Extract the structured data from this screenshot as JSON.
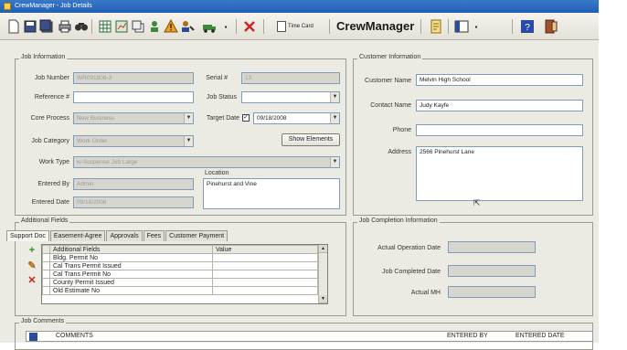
{
  "window": {
    "title": "CrewManager - Job Details"
  },
  "toolbar": {
    "time_card_label": "Time Card",
    "brand": "CrewManager",
    "buttons": [
      "new-icon",
      "save-icon",
      "save-all-icon",
      "print-icon",
      "find-icon",
      "grid-icon",
      "report-icon",
      "copy-icon",
      "crew-icon",
      "warning-icon",
      "assign-icon",
      "dispatch-icon",
      "delete-icon",
      "time-card-icon",
      "notes-icon",
      "view-icon",
      "help-icon",
      "exit-icon"
    ]
  },
  "job_info": {
    "title": "Job Information",
    "job_number_label": "Job Number",
    "job_number": "WR091808-3",
    "serial_label": "Serial #",
    "serial": "13",
    "reference_label": "Reference #",
    "reference": "",
    "job_status_label": "Job Status",
    "job_status": "",
    "core_process_label": "Core Process",
    "core_process": "New Business",
    "target_date_label": "Target Date",
    "target_date": "09/18/2008",
    "target_date_checked": true,
    "job_category_label": "Job Category",
    "job_category": "Work Order",
    "show_elements_label": "Show Elements",
    "work_type_label": "Work Type",
    "work_type": "w-Suspense Job Large",
    "entered_by_label": "Entered By",
    "entered_by": "Admin",
    "location_label": "Location",
    "location": "Pinehurst and Vine",
    "entered_date_label": "Entered Date",
    "entered_date": "09/18/2008"
  },
  "customer_info": {
    "title": "Customer Information",
    "customer_name_label": "Customer Name",
    "customer_name": "Melvin High School",
    "contact_name_label": "Contact Name",
    "contact_name": "Judy Kayfe",
    "phone_label": "Phone",
    "phone": "",
    "address_label": "Address",
    "address": "2566 Pinehurst Lane"
  },
  "additional_fields": {
    "title": "Additional Fields",
    "tabs": [
      "Support Doc",
      "Easement-Agree",
      "Approvals",
      "Fees",
      "Customer Payment"
    ],
    "columns": [
      "Additional Fields",
      "Value"
    ],
    "rows": [
      "Bldg. Permit No",
      "Cal Trans Permit Issued",
      "Cal Trans Permit No",
      "County Permit Issued",
      "Old Estimate No"
    ]
  },
  "job_completion": {
    "title": "Job Completion Information",
    "actual_operation_date_label": "Actual Operation Date",
    "actual_operation_date": "",
    "job_completed_date_label": "Job Completed Date",
    "job_completed_date": "",
    "actual_mh_label": "Actual MH",
    "actual_mh": ""
  },
  "job_comments": {
    "title": "Job Comments",
    "columns": [
      "COMMENTS",
      "ENTERED BY",
      "ENTERED DATE"
    ]
  }
}
